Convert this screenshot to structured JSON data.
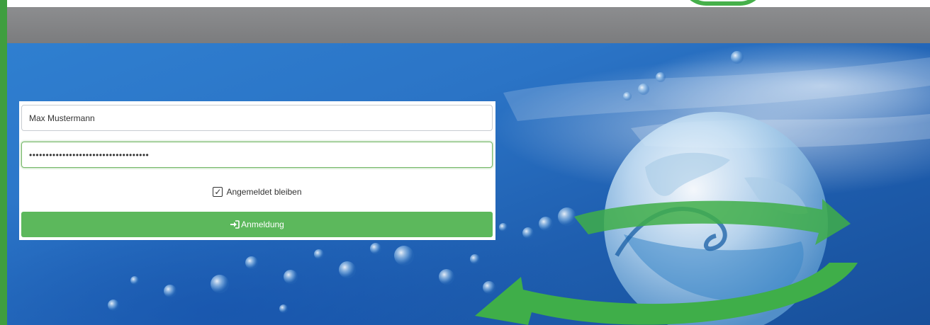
{
  "header": {
    "logo_icon": "green-arc-logo-icon",
    "bar_color": "#808183"
  },
  "colors": {
    "accent_green": "#5cb85c",
    "edge_green": "#3f9e3f",
    "hero_blue": "#2b74c6"
  },
  "login": {
    "username_value": "Max Mustermann",
    "password_value": "••••••••••••••••••••••••••••••••••••",
    "remember_label": "Angemeldet bleiben",
    "remember_checked": true,
    "submit_label": "Anmeldung",
    "submit_icon": "sign-in-icon"
  },
  "hero": {
    "image": "water-globe-recycle-arrows"
  }
}
